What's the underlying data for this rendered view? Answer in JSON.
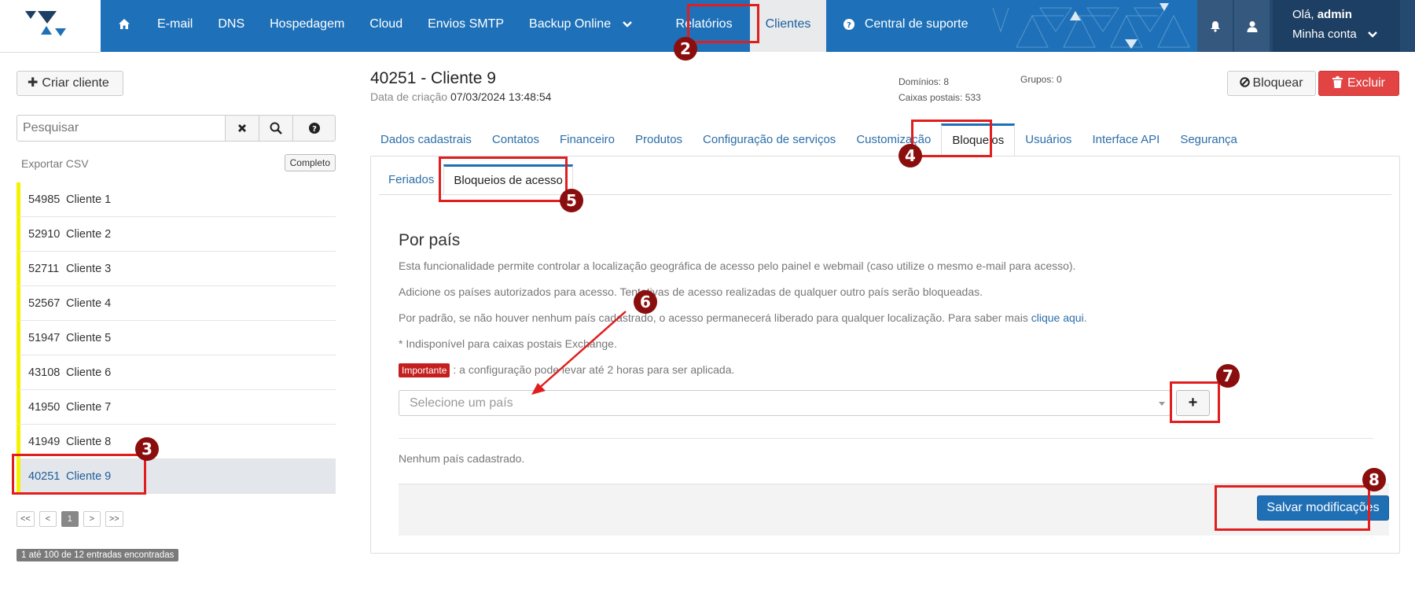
{
  "nav": {
    "items": [
      {
        "label": "E-mail"
      },
      {
        "label": "DNS"
      },
      {
        "label": "Hospedagem"
      },
      {
        "label": "Cloud"
      },
      {
        "label": "Envios SMTP"
      },
      {
        "label": "Backup Online"
      },
      {
        "label": "Relatórios"
      },
      {
        "label": "Clientes"
      },
      {
        "label": "Central de suporte"
      }
    ],
    "user": {
      "greeting": "Olá,",
      "name": "admin",
      "account": "Minha conta"
    }
  },
  "sidebar": {
    "create_label": "Criar cliente",
    "search_placeholder": "Pesquisar",
    "export_label": "Exportar CSV",
    "complete_label": "Completo",
    "clients": [
      {
        "id": "54985",
        "name": "Cliente 1"
      },
      {
        "id": "52910",
        "name": "Cliente 2"
      },
      {
        "id": "52711",
        "name": "Cliente 3"
      },
      {
        "id": "52567",
        "name": "Cliente 4"
      },
      {
        "id": "51947",
        "name": "Cliente 5"
      },
      {
        "id": "43108",
        "name": "Cliente 6"
      },
      {
        "id": "41950",
        "name": "Cliente 7"
      },
      {
        "id": "41949",
        "name": "Cliente 8"
      },
      {
        "id": "40251",
        "name": "Cliente 9"
      }
    ],
    "pager": [
      "<<",
      "<",
      "1",
      ">",
      ">>"
    ],
    "entries": "1 até 100 de 12 entradas encontradas"
  },
  "client": {
    "title": "40251 - Cliente 9",
    "created_label": "Data de criação",
    "created_value": "07/03/2024 13:48:54",
    "domains": "Domínios: 8",
    "mailboxes": "Caixas postais: 533",
    "groups": "Grupos: 0",
    "block_label": "Bloquear",
    "delete_label": "Excluir"
  },
  "tabs": [
    "Dados cadastrais",
    "Contatos",
    "Financeiro",
    "Produtos",
    "Configuração de serviços",
    "Customização",
    "Bloqueios",
    "Usuários",
    "Interface API",
    "Segurança"
  ],
  "subtabs": [
    "Feriados",
    "Bloqueios de acesso"
  ],
  "section": {
    "title": "Por país",
    "p1": "Esta funcionalidade permite controlar a localização geográfica de acesso pelo painel e webmail (caso utilize o mesmo e-mail para acesso).",
    "p2": "Adicione os países autorizados para acesso. Tentativas de acesso realizadas de qualquer outro país serão bloqueadas.",
    "p3": "Por padrão, se não houver nenhum país cadastrado, o acesso permanecerá liberado para qualquer localização. Para saber mais",
    "p3_link": "clique aqui",
    "p4": "* Indisponível para caixas postais Exchange.",
    "important_badge": "Importante",
    "important_text": ": a configuração pode levar até 2 horas para ser aplicada.",
    "select_placeholder": "Selecione um país",
    "add_label": "+",
    "empty_text": "Nenhum país cadastrado.",
    "save_label": "Salvar modificações"
  },
  "annotations": [
    "2",
    "3",
    "4",
    "5",
    "6",
    "7",
    "8"
  ],
  "colors": {
    "nav_blue": "#1e71b8",
    "highlight_red": "#e01e1e",
    "badge_red": "#8b0e0e",
    "list_marker": "#f5f200"
  }
}
